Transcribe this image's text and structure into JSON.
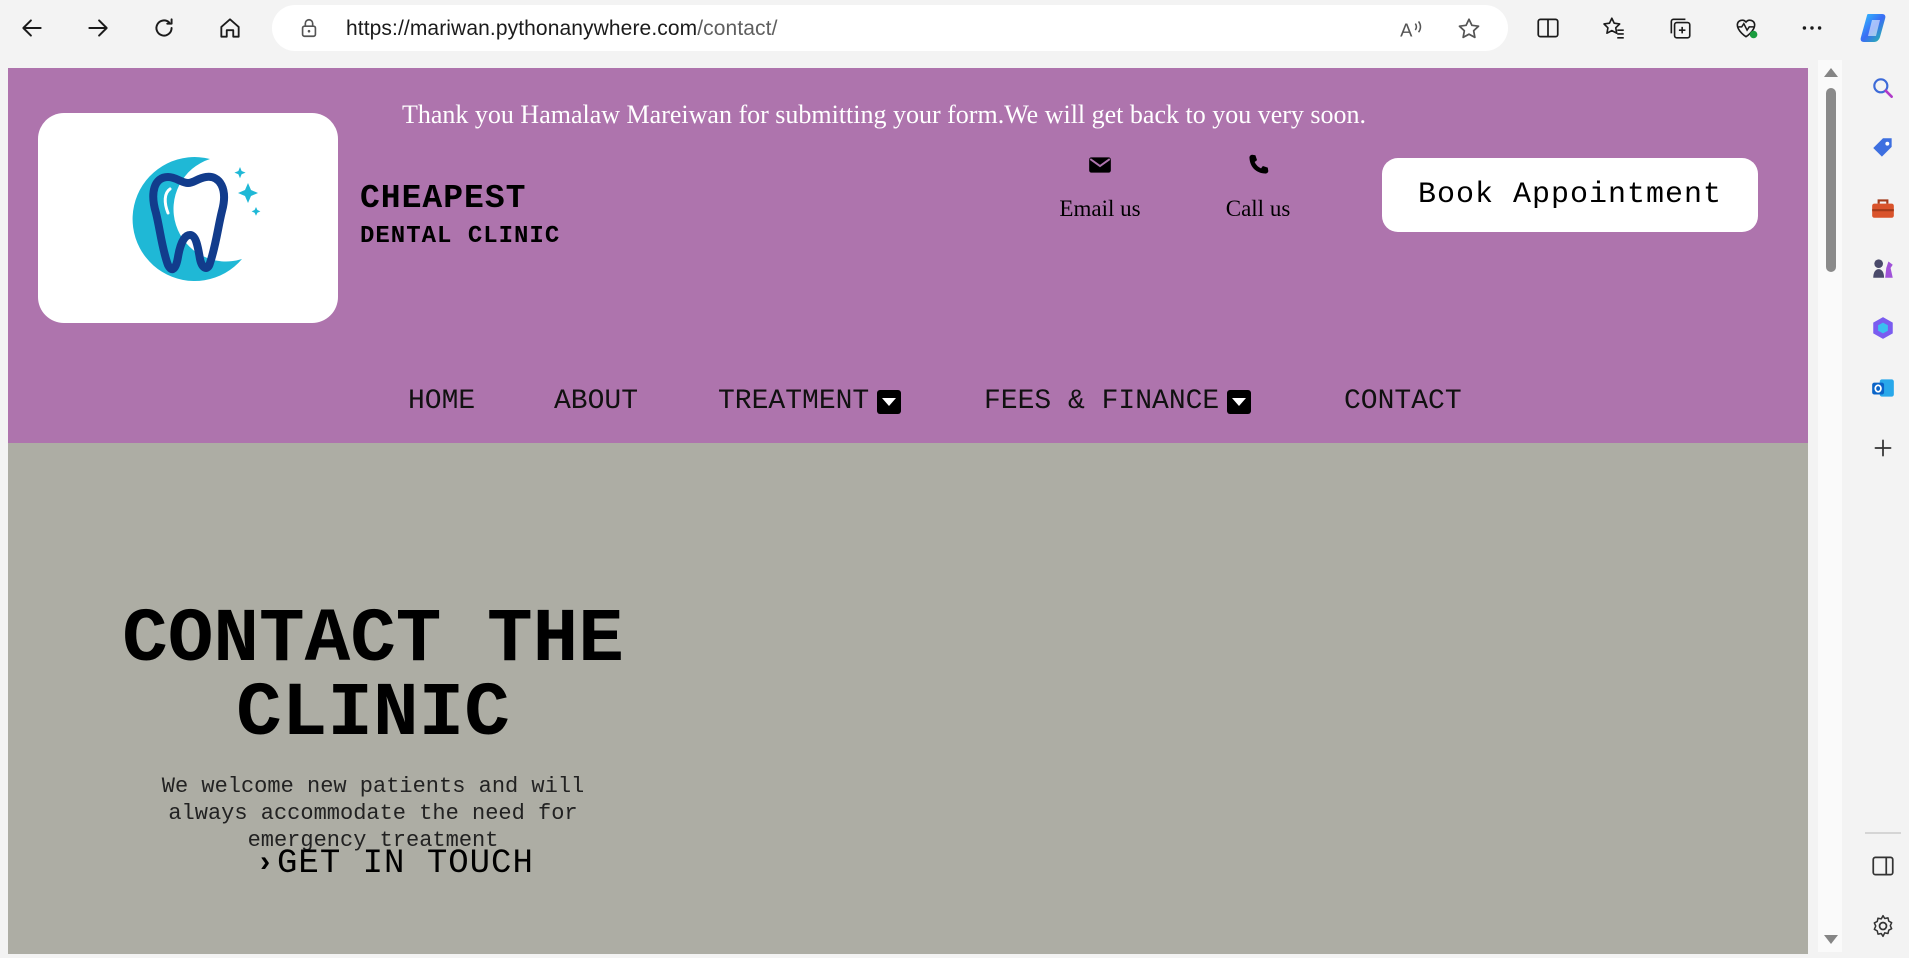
{
  "browser": {
    "url_host": "https://mariwan.pythonanywhere.com",
    "url_path": "/contact/"
  },
  "site": {
    "thanks_message": "Thank you Hamalaw Mareiwan for submitting your form.We will get back to you very soon.",
    "brand_line1": "CHEAPEST",
    "brand_line2": "DENTAL CLINIC",
    "email_label": "Email us",
    "call_label": "Call us",
    "book_button": "Book Appointment",
    "nav": {
      "home": "HOME",
      "about": "ABOUT",
      "treatment": "TREATMENT",
      "fees": "FEES & FINANCE",
      "contact": "CONTACT"
    },
    "hero": {
      "title_line1": "CONTACT THE",
      "title_line2": "CLINIC",
      "subtitle_line1": "We welcome new patients and will",
      "subtitle_line2": "always accommodate the need for",
      "subtitle_line3": "emergency treatment",
      "cta": "GET IN TOUCH"
    }
  },
  "colors": {
    "header_bg": "#ae74ad",
    "hero_bg": "#adada4",
    "logo_dark": "#123c8c",
    "logo_light": "#1fb8d6"
  }
}
